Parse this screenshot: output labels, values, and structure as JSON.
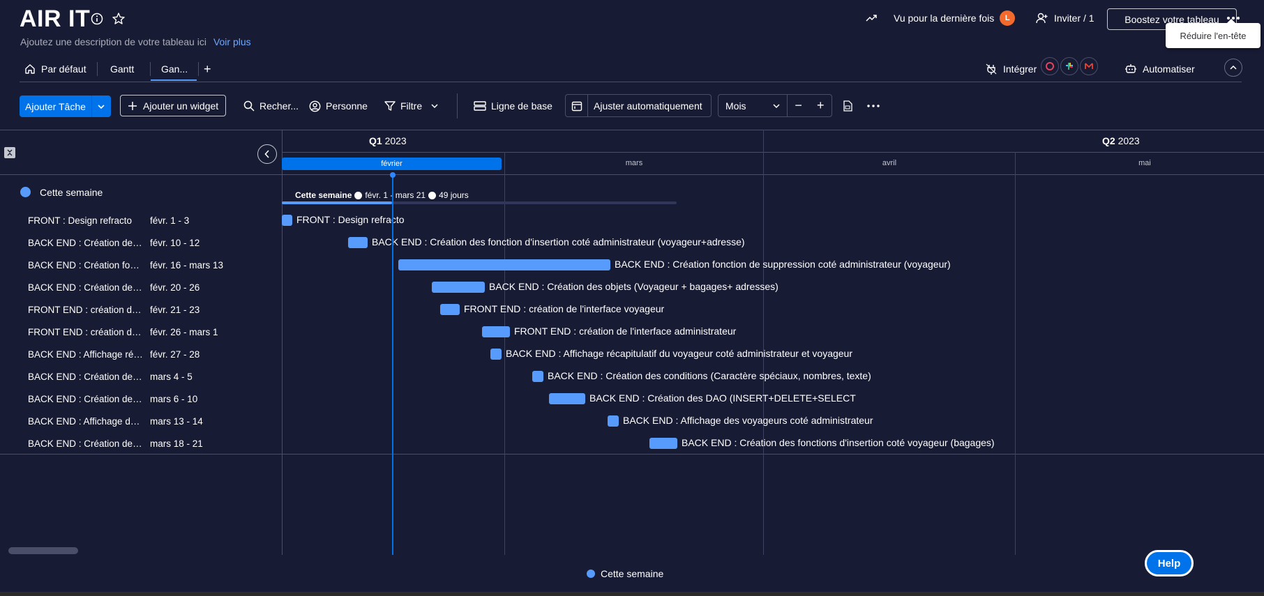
{
  "header": {
    "title": "AIR IT",
    "description": "Ajoutez une description de votre tableau ici",
    "see_more": "Voir plus",
    "last_seen": "Vu pour la dernière fois",
    "last_seen_avatar": "L",
    "invite": "Inviter / 1",
    "boost": "Boostez votre tableau",
    "tooltip": "Réduire l'en-tête"
  },
  "tabs": [
    {
      "label": "Par défaut",
      "icon": "home-icon"
    },
    {
      "label": "Gantt"
    },
    {
      "label": "Gan...",
      "active": true
    }
  ],
  "tabs_add": "+",
  "integrations": {
    "integrate": "Intégrer",
    "automate": "Automatiser"
  },
  "toolbar": {
    "add_task": "Ajouter Tâche",
    "add_widget": "Ajouter un widget",
    "search": "Recher...",
    "person": "Personne",
    "filter": "Filtre",
    "baseline": "Ligne de base",
    "autofit": "Ajuster automatiquement",
    "zoom_value": "Mois",
    "zoom_minus": "−",
    "zoom_plus": "+"
  },
  "timeline": {
    "quarters": [
      {
        "q": "Q1",
        "year": "2023"
      },
      {
        "q": "Q2",
        "year": "2023"
      }
    ],
    "months": [
      "février",
      "mars",
      "avril",
      "mai"
    ]
  },
  "group": {
    "name": "Cette semaine",
    "summary_name": "Cette semaine",
    "summary_range": "févr. 1 - mars 21",
    "summary_days": "49 jours",
    "color": "#579bfc"
  },
  "tasks": [
    {
      "name": "FRONT : Design refracto",
      "dates": "févr. 1 - 3",
      "label": "FRONT : Design refracto"
    },
    {
      "name": "BACK END : Création des fonction d'insertion coté administrateur (voyageur+adresse)",
      "dates": "févr. 10 - 12",
      "label": "BACK END : Création des fonction d'insertion coté administrateur (voyageur+adresse)"
    },
    {
      "name": "BACK END : Création fonction de suppression coté administrateur (voyageur)",
      "dates": "févr. 16 - mars 13",
      "label": "BACK END : Création fonction de suppression coté administrateur (voyageur)"
    },
    {
      "name": "BACK END : Création des objets (Voyageur + bagages+ adresses)",
      "dates": "févr. 20 - 26",
      "label": "BACK END : Création des objets (Voyageur + bagages+ adresses)"
    },
    {
      "name": "FRONT END : création de l'interface voyageur",
      "dates": "févr. 21 - 23",
      "label": "FRONT END : création de l'interface voyageur"
    },
    {
      "name": "FRONT END : création de l'interface administrateur",
      "dates": "févr. 26 - mars 1",
      "label": "FRONT END : création de l'interface administrateur"
    },
    {
      "name": "BACK END : Affichage récapitulatif du voyageur coté administrateur et voyageur",
      "dates": "févr. 27 - 28",
      "label": "BACK END : Affichage récapitulatif du voyageur coté administrateur et voyageur"
    },
    {
      "name": "BACK END : Création des conditions (Caractère spéciaux, nombres, texte)",
      "dates": "mars 4 - 5",
      "label": "BACK END : Création des conditions (Caractère spéciaux, nombres, texte)"
    },
    {
      "name": "BACK END : Création des DAO (INSERT+DELETE+SELECT",
      "dates": "mars 6 - 10",
      "label": "BACK END : Création des DAO (INSERT+DELETE+SELECT"
    },
    {
      "name": "BACK END : Affichage des voyageurs coté administrateur",
      "dates": "mars 13 - 14",
      "label": "BACK END : Affichage des voyageurs coté administrateur"
    },
    {
      "name": "BACK END : Création des fonctions d'insertion coté voyageur (bagages)",
      "dates": "mars 18 - 21",
      "label": "BACK END : Création des fonctions d'insertion coté voyageur (bagages)"
    }
  ],
  "legend": "Cette semaine",
  "help": "Help"
}
